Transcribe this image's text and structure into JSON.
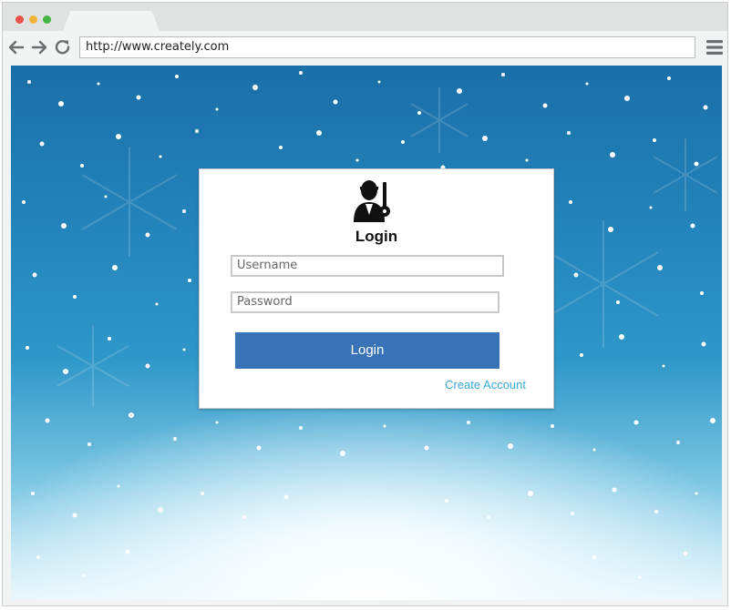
{
  "browser": {
    "url": "http://www.creately.com",
    "nav_icons": [
      "back-arrow-icon",
      "forward-arrow-icon",
      "reload-icon",
      "menu-hamburger-icon"
    ],
    "window_controls": {
      "close": "#e8524a",
      "minimize": "#f0b43a",
      "maximize": "#45b546"
    }
  },
  "login": {
    "icon": "user-key-icon",
    "title": "Login",
    "username_placeholder": "Username",
    "password_placeholder": "Password",
    "submit_label": "Login",
    "create_account_label": "Create Account"
  },
  "colors": {
    "accent_button": "#3973b7",
    "link": "#36a9d9",
    "background_top": "#1b6fa8"
  }
}
